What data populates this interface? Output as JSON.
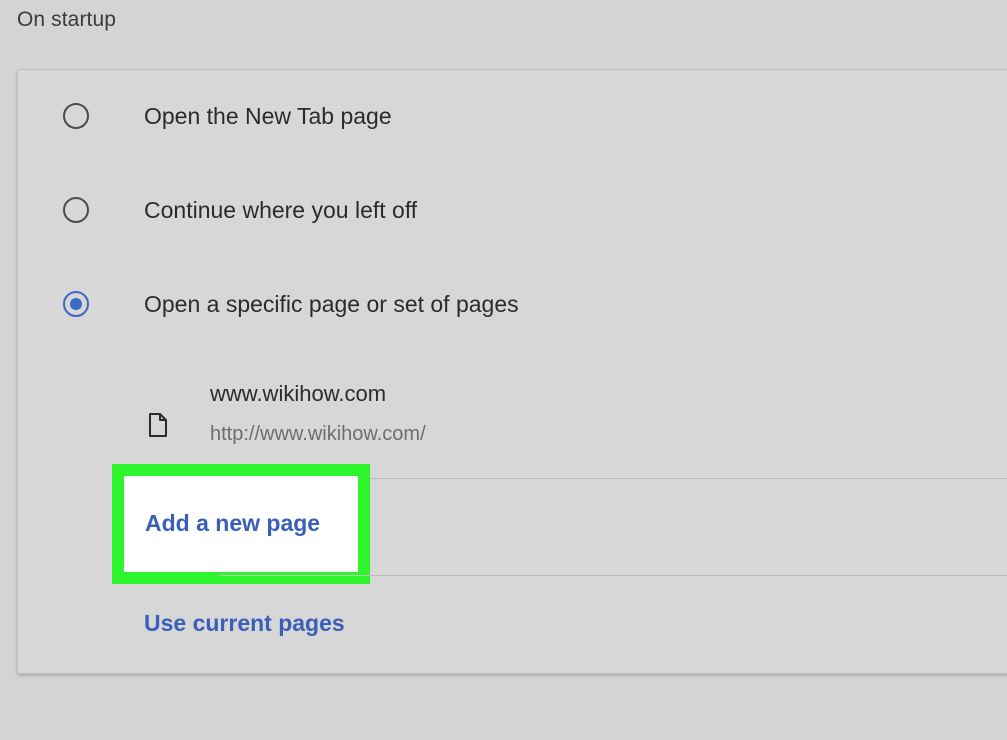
{
  "section": {
    "title": "On startup"
  },
  "startup_options": [
    {
      "label": "Open the New Tab page",
      "selected": false
    },
    {
      "label": "Continue where you left off",
      "selected": false
    },
    {
      "label": "Open a specific page or set of pages",
      "selected": true
    }
  ],
  "pages": [
    {
      "name": "www.wikihow.com",
      "url": "http://www.wikihow.com/",
      "icon": "page-icon"
    }
  ],
  "actions": {
    "add_new_page": "Add a new page",
    "use_current_pages": "Use current pages"
  },
  "colors": {
    "accent": "#3b68c7",
    "link": "#3a5fb8",
    "highlight": "#2cf52c",
    "background": "#d4d4d4"
  }
}
